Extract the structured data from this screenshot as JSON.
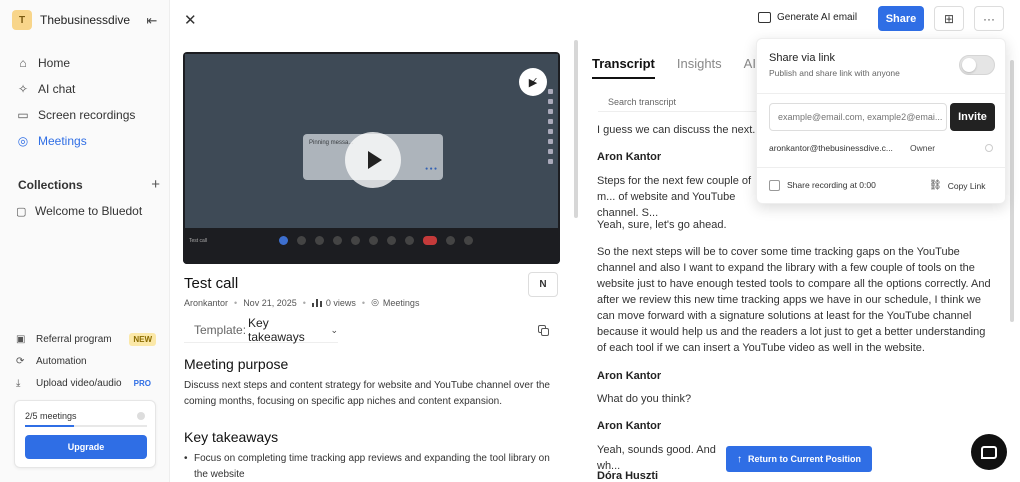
{
  "workspace": {
    "initial": "T",
    "name": "Thebusinessdive"
  },
  "nav": [
    {
      "label": "Home",
      "icon": "home-icon"
    },
    {
      "label": "AI chat",
      "icon": "sparkle-icon"
    },
    {
      "label": "Screen recordings",
      "icon": "screen-icon"
    },
    {
      "label": "Meetings",
      "icon": "meetings-icon",
      "active": true
    }
  ],
  "collections": {
    "heading": "Collections",
    "items": [
      {
        "label": "Welcome to Bluedot"
      }
    ]
  },
  "bottom_links": {
    "referral": {
      "label": "Referral program",
      "badge": "NEW"
    },
    "automation": {
      "label": "Automation"
    },
    "upload": {
      "label": "Upload video/audio",
      "badge": "PRO"
    }
  },
  "usage": {
    "label": "2/5 meetings",
    "progress": 0.4,
    "button": "Upgrade"
  },
  "topbar": {
    "generate_ai_email": "Generate AI email",
    "share": "Share"
  },
  "video": {
    "card_text": "Pinning messa...",
    "toolbar_label": "Test call"
  },
  "meeting": {
    "title": "Test call",
    "author": "Aronkantor",
    "date": "Nov 21, 2025",
    "views": "0 views",
    "folder": "Meetings",
    "template_label": "Template:",
    "template_value": "Key takeaways"
  },
  "summary": {
    "purpose_heading": "Meeting purpose",
    "purpose_text": "Discuss next steps and content strategy for website and YouTube channel over the coming months, focusing on specific app niches and content expansion.",
    "takeaways_heading": "Key takeaways",
    "takeaways": [
      "Focus on completing time tracking app reviews and expanding the tool library on the website"
    ]
  },
  "tabs": [
    {
      "label": "Transcript",
      "active": true
    },
    {
      "label": "Insights"
    },
    {
      "label": "AI c"
    }
  ],
  "search": {
    "placeholder": "Search transcript"
  },
  "transcript": {
    "line1": "I guess we can discuss the next.",
    "speaker1": "Aron Kantor",
    "line2": "Steps for the next few couple of m... of website and YouTube channel. S...",
    "line3": "Yeah, sure, let's go ahead.",
    "line4": "So the next steps will be to cover some time tracking gaps on the YouTube channel and also I want to expand the library with a few couple of tools on the website just to have enough tested tools to compare all the options correctly. And after we review this new time tracking apps we have in our schedule, I think we can move forward with a signature solutions at least for the YouTube channel because it would help us and the readers a lot just to get a better understanding of each tool if we can insert a YouTube video as well in the website.",
    "speaker2": "Aron Kantor",
    "line5": "What do you think?",
    "speaker3": "Aron Kantor",
    "line6": "Yeah, sounds good. And wh...",
    "speaker4": "Dóra Huszti"
  },
  "share_popover": {
    "title": "Share via link",
    "subtitle": "Publish and share link with anyone",
    "email_placeholder": "example@email.com, example2@emai...",
    "invite": "Invite",
    "owner_email": "aronkantor@thebusinessdive.c...",
    "owner_role": "Owner",
    "share_recording": "Share recording at 0:00",
    "copy_link": "Copy Link"
  },
  "return_button": "Return to Current Position",
  "colors": {
    "accent": "#2f6ee5",
    "dark": "#111111"
  }
}
